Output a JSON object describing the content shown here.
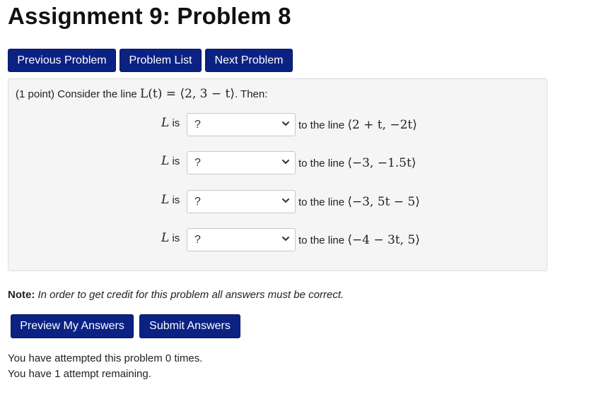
{
  "page": {
    "title": "Assignment 9: Problem 8"
  },
  "nav": {
    "previous_label": "Previous Problem",
    "list_label": "Problem List",
    "next_label": "Next Problem"
  },
  "problem": {
    "intro_prefix": "(1 point) Consider the line ",
    "intro_math": "L(t) = ⟨2, 3 − t⟩",
    "intro_suffix": ". Then:",
    "rows": [
      {
        "lhs_var": "L",
        "lhs_text": " is",
        "selected": "?",
        "rhs_text": "to the line ",
        "rhs_math": "⟨2 + t, −2t⟩"
      },
      {
        "lhs_var": "L",
        "lhs_text": " is",
        "selected": "?",
        "rhs_text": "to the line ",
        "rhs_math": "⟨−3, −1.5t⟩"
      },
      {
        "lhs_var": "L",
        "lhs_text": " is",
        "selected": "?",
        "rhs_text": "to the line ",
        "rhs_math": "⟨−3, 5t − 5⟩"
      },
      {
        "lhs_var": "L",
        "lhs_text": " is",
        "selected": "?",
        "rhs_text": "to the line ",
        "rhs_math": "⟨−4 − 3t, 5⟩"
      }
    ]
  },
  "note": {
    "label": "Note:",
    "text": " In order to get credit for this problem all answers must be correct."
  },
  "actions": {
    "preview_label": "Preview My Answers",
    "submit_label": "Submit Answers"
  },
  "status": {
    "attempts": "You have attempted this problem 0 times.",
    "remaining": "You have 1 attempt remaining."
  },
  "colors": {
    "button_bg": "#0b2283",
    "box_bg": "#f5f5f5"
  },
  "icons": {
    "select_arrow": "chevron-down-icon"
  }
}
